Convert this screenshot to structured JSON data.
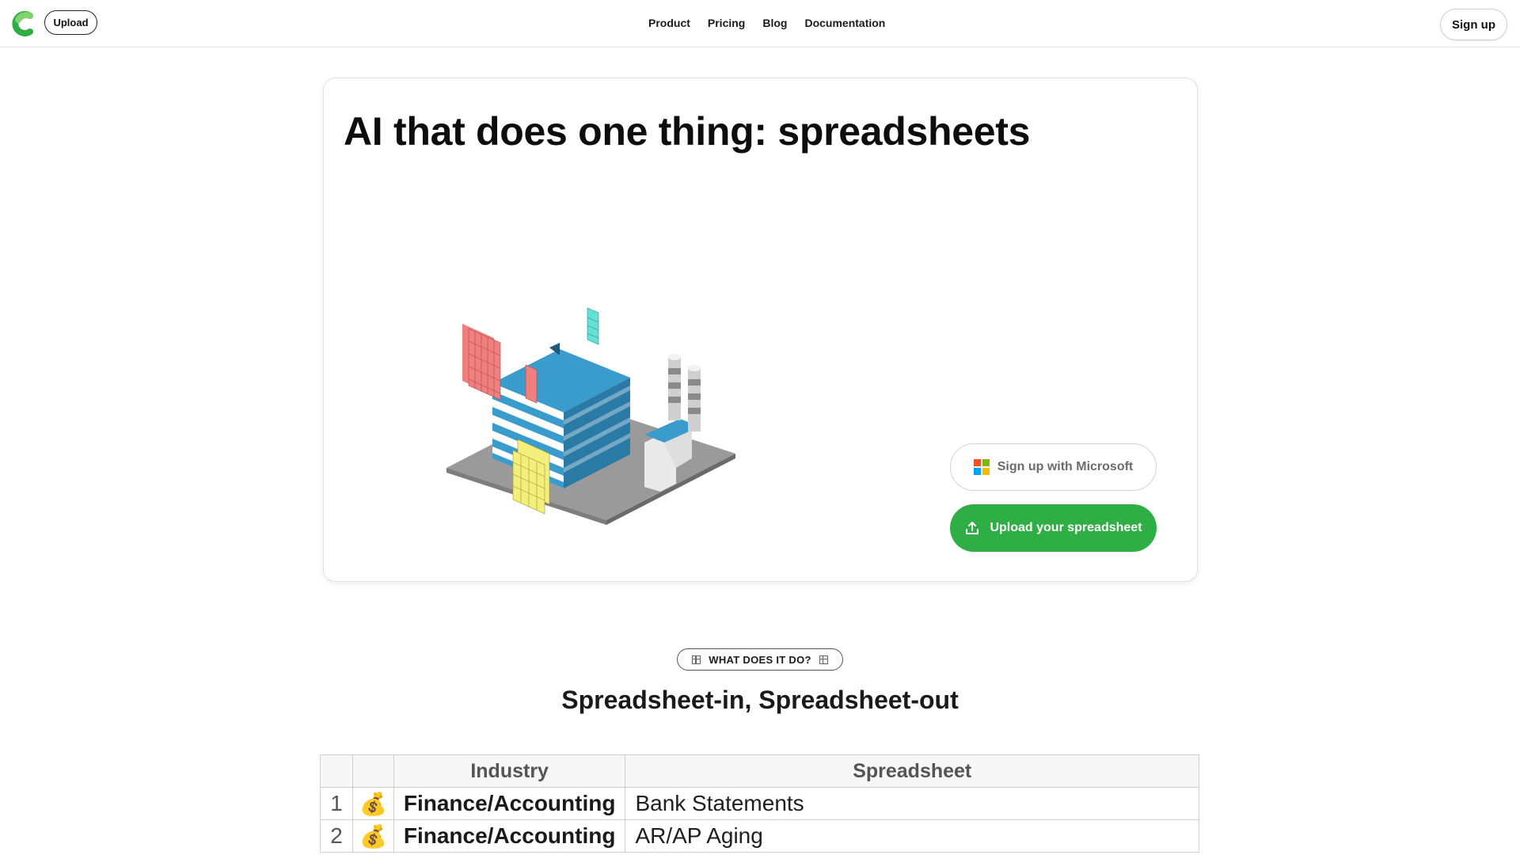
{
  "nav": {
    "upload_label": "Upload",
    "links": [
      "Product",
      "Pricing",
      "Blog",
      "Documentation"
    ],
    "signup_label": "Sign up"
  },
  "hero": {
    "title": "AI that does one thing: spreadsheets",
    "ms_button_label": "Sign up with Microsoft",
    "upload_button_label": "Upload your spreadsheet"
  },
  "section": {
    "badge_label": "WHAT DOES IT DO?",
    "title": "Spreadsheet-in, Spreadsheet-out"
  },
  "table": {
    "headers": [
      "",
      "",
      "Industry",
      "Spreadsheet"
    ],
    "rows": [
      {
        "num": "1",
        "emoji": "💰",
        "industry": "Finance/Accounting",
        "spreadsheet": "Bank Statements"
      },
      {
        "num": "2",
        "emoji": "💰",
        "industry": "Finance/Accounting",
        "spreadsheet": "AR/AP Aging"
      }
    ]
  },
  "colors": {
    "brand_green": "#2fae45",
    "building_blue": "#3a9ccc",
    "ms_red": "#f25022",
    "ms_green": "#7fba00",
    "ms_blue": "#00a4ef",
    "ms_yellow": "#ffb900"
  }
}
